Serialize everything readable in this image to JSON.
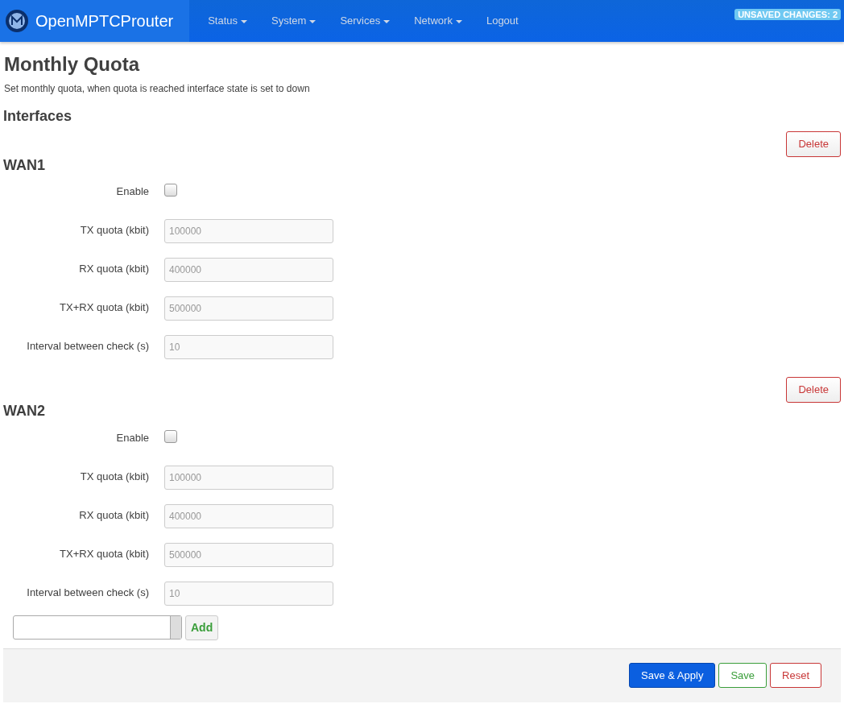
{
  "navbar": {
    "brand": "OpenMPTCProuter",
    "items": [
      {
        "label": "Status",
        "kind": "dropdown"
      },
      {
        "label": "System",
        "kind": "dropdown"
      },
      {
        "label": "Services",
        "kind": "dropdown"
      },
      {
        "label": "Network",
        "kind": "dropdown"
      },
      {
        "label": "Logout",
        "kind": "link"
      }
    ],
    "badge": "UNSAVED CHANGES: 2"
  },
  "page": {
    "title": "Monthly Quota",
    "description": "Set monthly quota, when quota is reached interface state is set to down",
    "section_title": "Interfaces"
  },
  "interfaces": [
    {
      "name": "WAN1",
      "delete_label": "Delete",
      "fields": [
        {
          "kind": "checkbox",
          "label": "Enable",
          "checked": false
        },
        {
          "kind": "text",
          "label": "TX quota (kbit)",
          "placeholder": "100000"
        },
        {
          "kind": "text",
          "label": "RX quota (kbit)",
          "placeholder": "400000"
        },
        {
          "kind": "text",
          "label": "TX+RX quota (kbit)",
          "placeholder": "500000"
        },
        {
          "kind": "text",
          "label": "Interval between check (s)",
          "placeholder": "10"
        }
      ]
    },
    {
      "name": "WAN2",
      "delete_label": "Delete",
      "fields": [
        {
          "kind": "checkbox",
          "label": "Enable",
          "checked": false
        },
        {
          "kind": "text",
          "label": "TX quota (kbit)",
          "placeholder": "100000"
        },
        {
          "kind": "text",
          "label": "RX quota (kbit)",
          "placeholder": "400000"
        },
        {
          "kind": "text",
          "label": "TX+RX quota (kbit)",
          "placeholder": "500000"
        },
        {
          "kind": "text",
          "label": "Interval between check (s)",
          "placeholder": "10"
        }
      ]
    }
  ],
  "add": {
    "button": "Add"
  },
  "footer": {
    "buttons": [
      {
        "label": "Save & Apply",
        "kind": "primary"
      },
      {
        "label": "Save",
        "kind": "success"
      },
      {
        "label": "Reset",
        "kind": "danger"
      }
    ]
  }
}
